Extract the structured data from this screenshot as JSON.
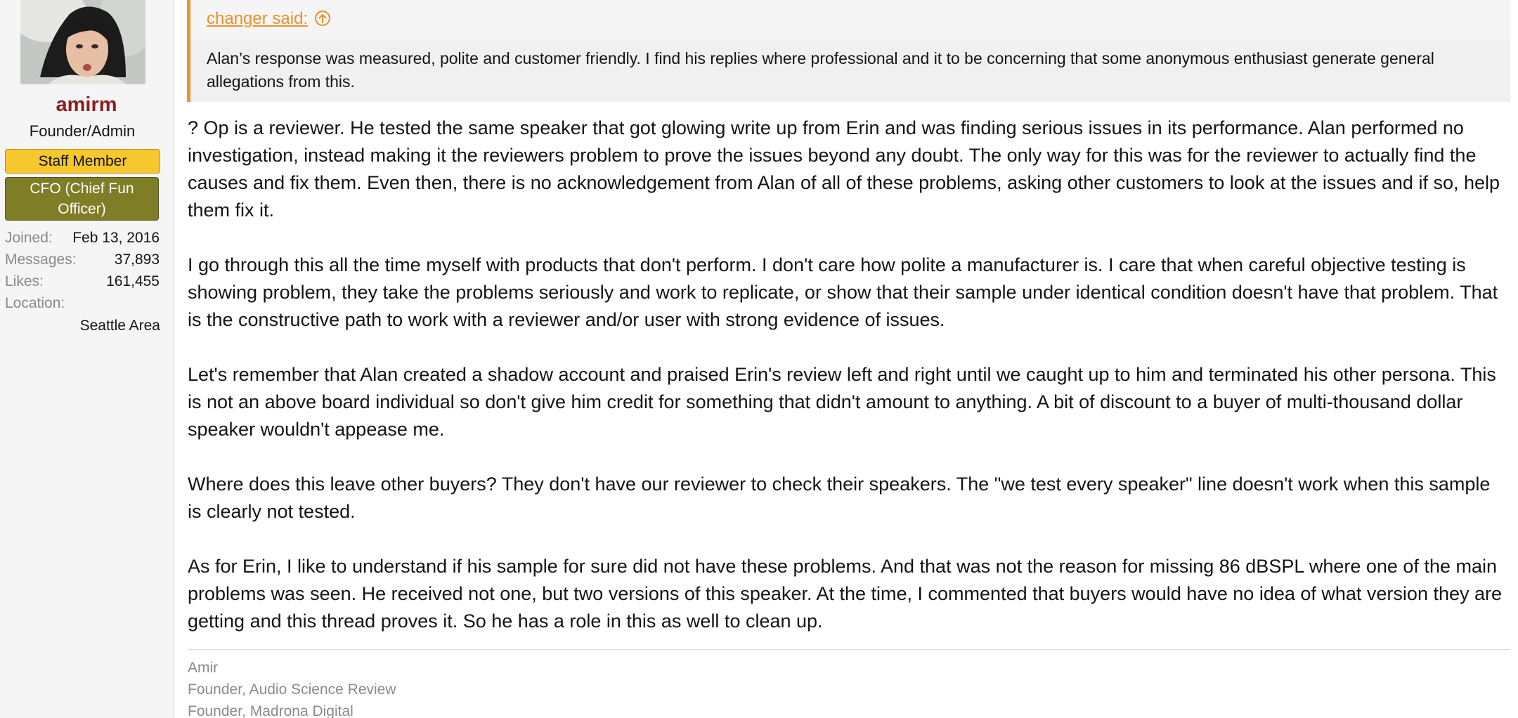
{
  "user": {
    "name": "amirm",
    "title": "Founder/Admin",
    "badges": {
      "staff": "Staff Member",
      "cfo": "CFO (Chief Fun Officer)"
    },
    "stats": {
      "joined_label": "Joined:",
      "joined_value": "Feb 13, 2016",
      "messages_label": "Messages:",
      "messages_value": "37,893",
      "likes_label": "Likes:",
      "likes_value": "161,455",
      "location_label": "Location:",
      "location_value": "Seattle Area"
    }
  },
  "quote": {
    "author_line": "changer said:",
    "text": "Alan’s response was measured, polite and customer friendly. I find his replies where professional and it to be concerning that some anonymous enthusiast generate general allegations from this."
  },
  "post": {
    "paragraphs": [
      "? Op is a reviewer. He tested the same speaker that got glowing write up from Erin and was finding serious issues in its performance. Alan performed no investigation, instead making it the reviewers problem to prove the issues beyond any doubt. The only way for this was for the reviewer to actually find the causes and fix them. Even then, there is no acknowledgement from Alan of all of these problems, asking other customers to look at the issues and if so, help them fix it.",
      "I go through this all the time myself with products that don't perform. I don't care how polite a manufacturer is. I care that when careful objective testing is showing problem, they take the problems seriously and work to replicate, or show that their sample under identical condition doesn't have that problem. That is the constructive path to work with a reviewer and/or user with strong evidence of issues.",
      "Let's remember that Alan created a shadow account and praised Erin's review left and right until we caught up to him and terminated his other persona. This is not an above board individual so don't give him credit for something that didn't amount to anything. A bit of discount to a buyer of multi-thousand dollar speaker wouldn't appease me.",
      "Where does this leave other buyers? They don't have our reviewer to check their speakers. The \"we test every speaker\" line doesn't work when this sample is clearly not tested.",
      "As for Erin, I like to understand if his sample for sure did not have these problems. And that was not the reason for missing 86 dBSPL where one of the main problems was seen. He received not one, but two versions of this speaker. At the time, I commented that buyers would have no idea of what version they are getting and this thread proves it. So he has a role in this as well to clean up."
    ]
  },
  "signature": {
    "lines": [
      "Amir",
      "Founder, Audio Science Review",
      "Founder, Madrona Digital"
    ]
  },
  "colors": {
    "username": "#8c1e1e",
    "quote_accent": "#f0922d",
    "staff_badge": "#f7c72e",
    "cfo_badge": "#7f7d26"
  }
}
